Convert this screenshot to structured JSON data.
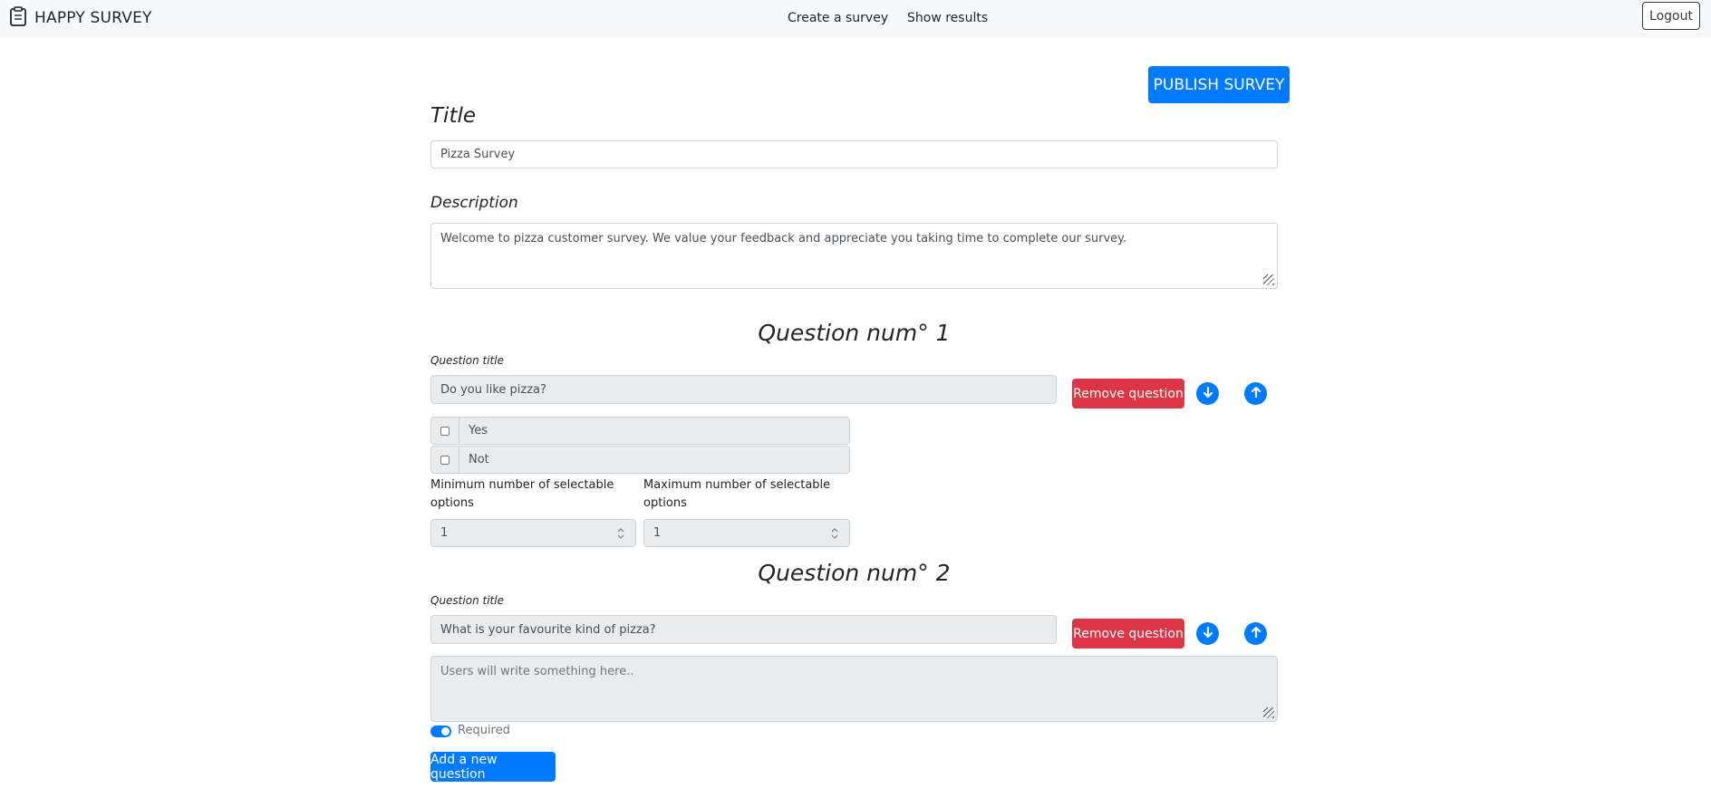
{
  "navbar": {
    "brand": "HAPPY SURVEY",
    "brand_icon": "clipboard-icon",
    "links": [
      "Create a survey",
      "Show results"
    ],
    "logout_label": "Logout"
  },
  "publish_label": "PUBLISH SURVEY",
  "form": {
    "title_label": "Title",
    "title_value": "Pizza Survey",
    "description_label": "Description",
    "description_value": "Welcome to pizza customer survey. We value your feedback and appreciate you taking time to complete our survey."
  },
  "questions": [
    {
      "heading": "Question num° 1",
      "title_label": "Question title",
      "title_value": "Do you like pizza?",
      "remove_label": "Remove question",
      "options": [
        "Yes",
        "Not"
      ],
      "min_label": "Minimum number of selectable options",
      "min_value": "1",
      "max_label": "Maximum number of selectable options",
      "max_value": "1"
    },
    {
      "heading": "Question num° 2",
      "title_label": "Question title",
      "title_value": "What is your favourite kind of pizza?",
      "remove_label": "Remove question",
      "answer_placeholder": "Users will write something here..",
      "required_label": "Required",
      "required": true
    }
  ],
  "add_question_label": "Add a new question",
  "colors": {
    "primary": "#007bff",
    "danger": "#dc3545",
    "navbar_bg": "#f8f9fa",
    "disabled_bg": "#e9ecef"
  }
}
